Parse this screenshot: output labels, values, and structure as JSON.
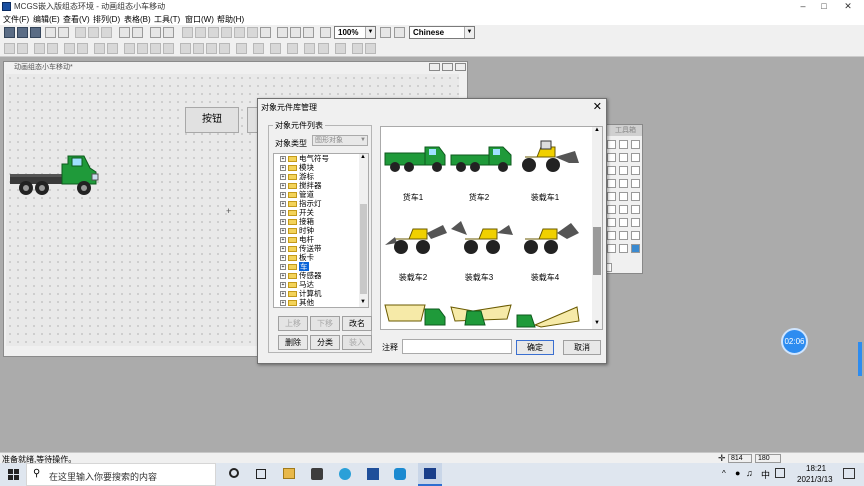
{
  "window": {
    "title": "MCGS嵌入版组态环境 - 动画组态小车移动"
  },
  "menu": [
    "文件(F)",
    "编辑(E)",
    "查看(V)",
    "排列(D)",
    "表格(B)",
    "工具(T)",
    "窗口(W)",
    "帮助(H)"
  ],
  "toolbar": {
    "zoom": "100%",
    "language": "Chinese"
  },
  "editor": {
    "title": "动画组态小车移动*",
    "button_label": "按钮"
  },
  "palette": {
    "title": "工具箱"
  },
  "dialog": {
    "title": "对象元件库管理",
    "group_label": "对象元件列表",
    "type_label": "对象类型",
    "type_value": "图形对象",
    "tree": [
      "电气符号",
      "模块",
      "游标",
      "搅拌器",
      "管道",
      "指示灯",
      "开关",
      "接箱",
      "时钟",
      "电杆",
      "传送带",
      "板卡",
      "车",
      "传感器",
      "马达",
      "计算机",
      "其他"
    ],
    "selected": "车",
    "buttons": {
      "up": "上移",
      "down": "下移",
      "rename": "改名",
      "delete": "删除",
      "category": "分类",
      "insert": "装入",
      "ok": "确定",
      "cancel": "取消"
    },
    "note_label": "注释",
    "captions": [
      "货车1",
      "货车2",
      "装载车1",
      "装载车2",
      "装载车3",
      "装载车4"
    ]
  },
  "status": {
    "text": "准备就绪,等待操作。",
    "cell1": "814",
    "cell2": "180"
  },
  "taskbar": {
    "search_placeholder": "在这里输入你要搜索的内容",
    "time": "18:21",
    "date": "2021/3/13",
    "ime": "中",
    "clock_bubble": "02:06"
  },
  "colors": {
    "accent": "#0a64d8",
    "truck_green": "#1f9a3a",
    "loader_yellow": "#f0d000"
  }
}
